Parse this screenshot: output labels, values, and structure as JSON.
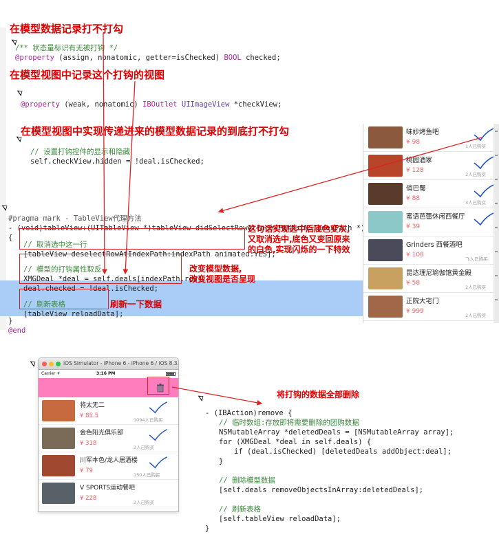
{
  "annotations": {
    "a1": "在模型数据记录打不打勾",
    "a2": "在模型视图中记录这个打钩的视图",
    "a3": "在模型视图中实现传递进来的模型数据记录的到底打不打勾",
    "a4_line1": "这句话实现选中后底色变灰,",
    "a4_line2": "又取消选中,底色又变回原来",
    "a4_line3": "的白色,实现闪烁的一下特效",
    "a5_line1": "改变模型数据,",
    "a5_line2": "改变视图是否呈现",
    "a6": "刷新一下数据",
    "a7": "将打钩的数据全部删除"
  },
  "code": {
    "c1_comment": "/** 状态量标识有无被打钩 */",
    "c1_prop": "@property",
    "c1_attrs": " (assign, nonatomic, getter=isChecked) ",
    "c1_type": "BOOL",
    "c1_name": " checked;",
    "c2_prop": "@property",
    "c2_attrs": " (weak, nonatomic) ",
    "c2_outlet": "IBOutlet",
    "c2_type": " UIImageView",
    "c2_name": " *checkView;",
    "c3_comment": "// 设置打钩控件的显示和隐藏",
    "c3_code": "self.checkView.hidden = !deal.isChecked;",
    "m_pragma": "#pragma mark - TableView代理方法",
    "m_sig": "- (void)tableView:(UITableView *)tableView didSelectRowAtIndexPath:(NSIndexPath *)indexPath",
    "m_open": "{",
    "m_c1": "// 取消选中这一行",
    "m_l1": "[tableView deselectRowAtIndexPath:indexPath animated:YES];",
    "m_c2": "// 模型的打钩属性取反",
    "m_l2": "XMGDeal *deal = self.deals[indexPath.row];",
    "m_l3": "deal.checked = !deal.isChecked;",
    "m_c3": "// 刷新表格",
    "m_l4": "[tableView reloadData];",
    "m_close": "}",
    "m_end": "@end",
    "r_sig": "- (IBAction)remove {",
    "r_c1": "// 临时数组:存放即将需要删除的团购数据",
    "r_l1": "NSMutableArray *deletedDeals = [NSMutableArray array];",
    "r_l2": "for (XMGDeal *deal in self.deals) {",
    "r_l3": "if (deal.isChecked) [deletedDeals addObject:deal];",
    "r_l4": "}",
    "r_c2": "// 删除模型数据",
    "r_l5": "[self.deals removeObjectsInArray:deletedDeals];",
    "r_c3": "// 刷新表格",
    "r_l6": "[self.tableView reloadData];",
    "r_close": "}"
  },
  "right_list": [
    {
      "name": "味妙烤鱼吧",
      "price": "¥ 98",
      "sold": "1人已购买",
      "checked": true,
      "color": "#8b5a3c"
    },
    {
      "name": "桃园酒家",
      "price": "¥ 128",
      "sold": "2人已购买",
      "checked": true,
      "color": "#b8452a"
    },
    {
      "name": "俏巴蜀",
      "price": "¥ 88",
      "sold": "3人已购买",
      "checked": true,
      "color": "#5a3a2a"
    },
    {
      "name": "蜜语芭蕾休闲西餐厅",
      "price": "¥ 39",
      "sold": "",
      "checked": true,
      "color": "#8cc8c8"
    },
    {
      "name": "Grinders 西餐酒吧",
      "price": "¥ 108",
      "sold": "飞人已购买",
      "checked": false,
      "color": "#4a4a5a"
    },
    {
      "name": "昆达理尼瑜伽馆黄金殿",
      "price": "¥ 58",
      "sold": "2人已购买",
      "checked": false,
      "color": "#c8a060"
    },
    {
      "name": "正院大宅门",
      "price": "¥ 999",
      "sold": "2人已购买",
      "checked": false,
      "color": "#a06848"
    }
  ],
  "simulator": {
    "title": "iOS Simulator - iPhone 6 - iPhone 6 / iOS 8.3...",
    "carrier": "Carrier ✈",
    "time": "3:16 PM",
    "rows": [
      {
        "name": "将太无二",
        "price": "¥ 85.5",
        "sold": "1094人已购买",
        "checked": true,
        "color": "#c86a40"
      },
      {
        "name": "金色阳光俱乐部",
        "price": "¥ 318",
        "sold": "2人已购买",
        "checked": true,
        "color": "#7a6a58"
      },
      {
        "name": "川军本色/龙人居酒楼",
        "price": "¥ 79",
        "sold": "150人已购买",
        "checked": true,
        "color": "#a04830"
      },
      {
        "name": "V SPORTS运动餐吧",
        "price": "¥ 228",
        "sold": "2人已购买",
        "checked": false,
        "color": "#586068"
      }
    ]
  }
}
